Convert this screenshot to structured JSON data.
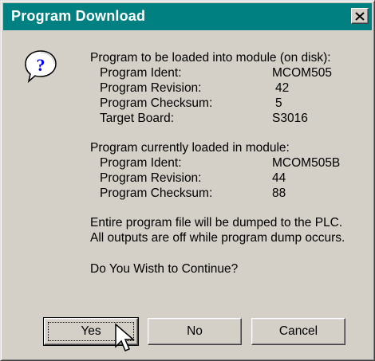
{
  "window": {
    "title": "Program Download",
    "close_glyph": "X"
  },
  "icon": {
    "name": "question-icon",
    "glyph": "?"
  },
  "message": {
    "section1_header": "Program to be loaded into module (on disk):",
    "section1_rows": [
      {
        "label": "Program Ident:",
        "value": "MCOM505"
      },
      {
        "label": "Program Revision:",
        "value": "42"
      },
      {
        "label": "Program Checksum:",
        "value": "5"
      },
      {
        "label": "Target Board:",
        "value": "S3016"
      }
    ],
    "section2_header": "Program currently loaded in module:",
    "section2_rows": [
      {
        "label": "Program Ident:",
        "value": "MCOM505B"
      },
      {
        "label": "Program Revision:",
        "value": "44"
      },
      {
        "label": "Program Checksum:",
        "value": "88"
      }
    ],
    "note_line1": "Entire program file will be dumped to the PLC.",
    "note_line2": "All outputs are off while program dump occurs.",
    "question": "Do You Wisth to Continue?"
  },
  "buttons": {
    "yes": "Yes",
    "no": "No",
    "cancel": "Cancel"
  },
  "colors": {
    "titlebar": "#008080",
    "dialog_face": "#d4d0c8",
    "icon_blue": "#0000ff"
  }
}
